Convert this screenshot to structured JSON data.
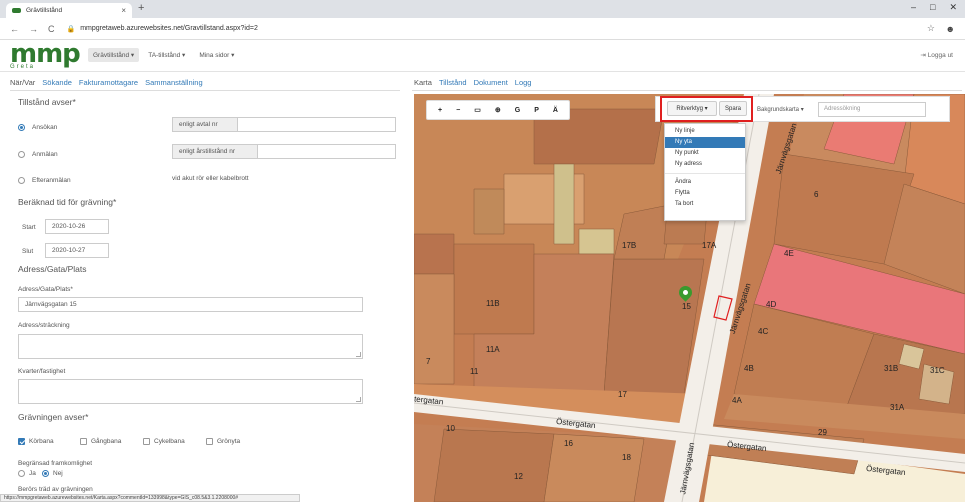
{
  "browser": {
    "tab_title": "Grävtillstånd",
    "tab_close": "×",
    "new_tab": "+",
    "url": "mmpgretaweb.azurewebsites.net/Gravtillstand.aspx?id=2",
    "win_min": "–",
    "win_max": "□",
    "win_close": "✕"
  },
  "app": {
    "logo": "mmp",
    "logo_sub": "Greta",
    "menu": [
      "Grävtillstånd ▾",
      "TA-tillstånd ▾",
      "Mina sidor ▾"
    ],
    "logout": "Logga ut"
  },
  "left": {
    "tabs": [
      "När/Var",
      "Sökande",
      "Fakturamottagare",
      "Sammanställning"
    ],
    "section_tillstand": "Tillstånd avser*",
    "radio_ansokan": "Ansökan",
    "radio_anmalan": "Anmälan",
    "radio_efteranmalan": "Efteranmälan",
    "addon_avtal": "enligt avtal nr",
    "addon_arstillstand": "enligt årstillstånd nr",
    "efter_note": "vid akut rör eller kabelbrott",
    "section_tid": "Beräknad tid för grävning*",
    "start_label": "Start",
    "start_value": "2020-10-26",
    "slut_label": "Slut",
    "slut_value": "2020-10-27",
    "section_adress": "Adress/Gata/Plats",
    "adress_label": "Adress/Gata/Plats*",
    "adress_value": "Järnvägsgatan 15",
    "adress_strackning_label": "Adress/sträckning",
    "kvarter_label": "Kvarter/fastighet",
    "section_gravning": "Grävningen avser*",
    "cb_korbana": "Körbana",
    "cb_gangbana": "Gångbana",
    "cb_cykelbana": "Cykelbana",
    "cb_gronyta": "Grönyta",
    "begransad_label": "Begränsad framkomlighet",
    "ja": "Ja",
    "nej": "Nej",
    "berors_label": "Berörs träd av grävningen",
    "status_url": "https://mmpgretaweb.azurewebsites.net/Karta.aspx?commentId=133998&type=GIS_c08.5&3.1.2208000#"
  },
  "right": {
    "tabs": [
      "Karta",
      "Tillstånd",
      "Dokument",
      "Logg"
    ],
    "toolbar": [
      "+",
      "−",
      "▭",
      "⊕",
      "G",
      "P",
      "Ä"
    ],
    "ritverktyg": "Ritverktyg ▾",
    "spara": "Spara",
    "bakgrundskarta": "Bakgrundskarta ▾",
    "adressokning": "Adressökning",
    "menu_items": [
      "Ny linje",
      "Ny yta",
      "Ny punkt",
      "Ny adress"
    ],
    "menu_items2": [
      "Ändra",
      "Flytta",
      "Ta bort"
    ]
  },
  "map": {
    "labels": {
      "n6": "6",
      "n17b": "17B",
      "n17a": "17A",
      "n4e": "4E",
      "n11b": "11B",
      "n15": "15",
      "n4d": "4D",
      "n4c": "4C",
      "n11a": "11A",
      "n7": "7",
      "n11": "11",
      "n4b": "4B",
      "n31b": "31B",
      "n31c": "31C",
      "n17": "17",
      "n4a": "4A",
      "n31a": "31A",
      "n10": "10",
      "n16": "16",
      "n18": "18",
      "n29": "29",
      "n12": "12"
    },
    "streets": {
      "jarn1": "Järnvägsgatan",
      "jarn2": "Järnvägsgatan",
      "jarn3": "Järnvägsgatan",
      "oster1": "Östergatan",
      "oster2": "Östergatan",
      "oster3": "Östergatan",
      "tergatan": "tergatan"
    }
  }
}
